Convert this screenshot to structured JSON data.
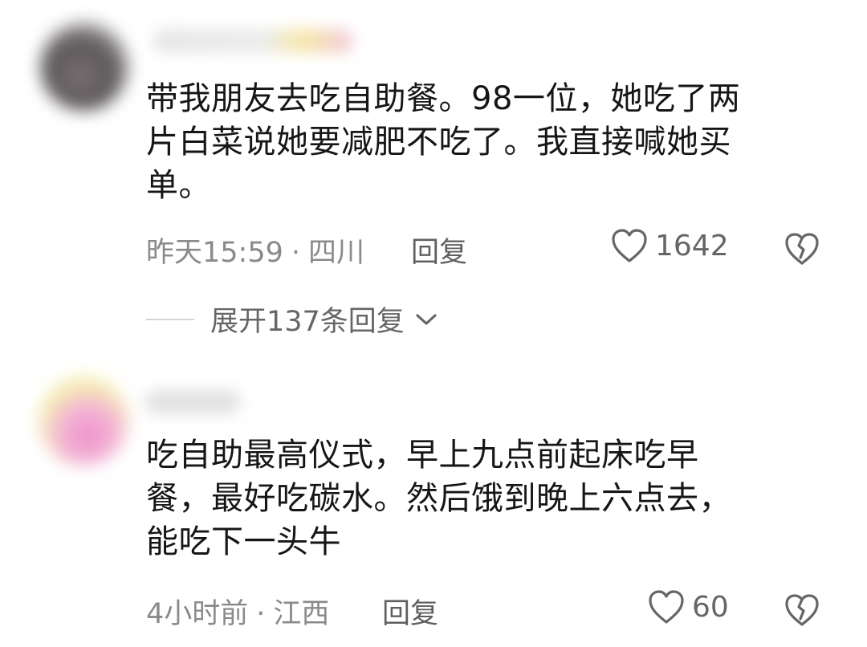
{
  "comments": [
    {
      "text": "带我朋友去吃自助餐。98一位，她吃了两\n片白菜说她要减肥不吃了。我直接喊她买\n单。",
      "time": "昨天15:59",
      "location": "四川",
      "reply_label": "回复",
      "likes": "1642",
      "expand_label": "展开137条回复"
    },
    {
      "text": "吃自助最高仪式，早上九点前起床吃早\n餐，最好吃碳水。然后饿到晚上六点去，\n能吃下一头牛",
      "time": "4小时前",
      "location": "江西",
      "reply_label": "回复",
      "likes": "60"
    }
  ],
  "meta_separator": "·",
  "colors": {
    "text": "#161616",
    "meta": "#8a8a8a",
    "icon": "#666666",
    "background": "#ffffff"
  },
  "icons": {
    "like": "heart-outline-icon",
    "dislike": "broken-heart-icon",
    "expand": "chevron-down-icon"
  }
}
